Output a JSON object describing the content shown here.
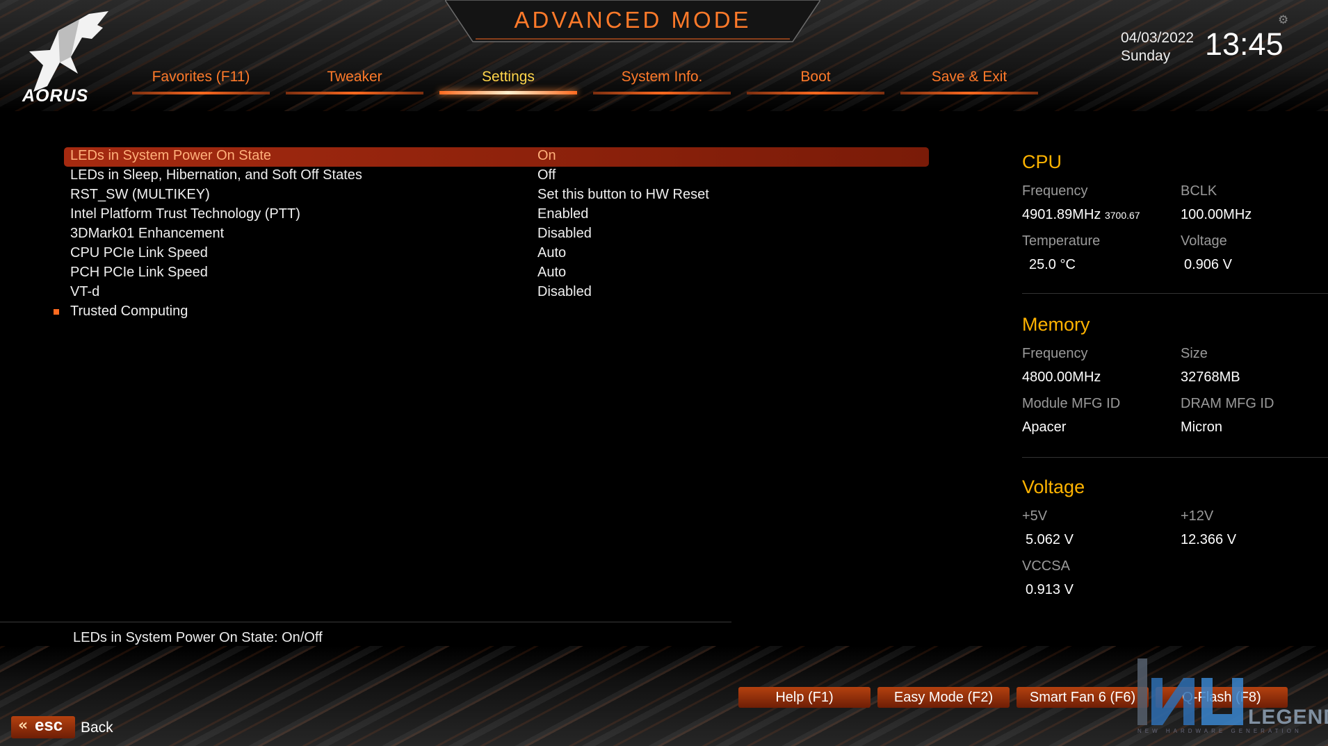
{
  "header": {
    "logo_text": "AORUS",
    "title": "ADVANCED MODE",
    "date": "04/03/2022",
    "day": "Sunday",
    "time": "13:45"
  },
  "tabs": [
    {
      "label": "Favorites (F11)",
      "active": false
    },
    {
      "label": "Tweaker",
      "active": false
    },
    {
      "label": "Settings",
      "active": true
    },
    {
      "label": "System Info.",
      "active": false
    },
    {
      "label": "Boot",
      "active": false
    },
    {
      "label": "Save & Exit",
      "active": false
    }
  ],
  "settings": [
    {
      "label": "LEDs in System Power On State",
      "value": "On",
      "selected": true
    },
    {
      "label": "LEDs in Sleep, Hibernation, and Soft Off States",
      "value": "Off"
    },
    {
      "label": "RST_SW (MULTIKEY)",
      "value": "Set this button to HW Reset"
    },
    {
      "label": "Intel Platform Trust Technology (PTT)",
      "value": "Enabled"
    },
    {
      "label": "3DMark01 Enhancement",
      "value": "Disabled"
    },
    {
      "label": "CPU PCIe Link Speed",
      "value": "Auto"
    },
    {
      "label": "PCH PCIe Link Speed",
      "value": "Auto"
    },
    {
      "label": "VT-d",
      "value": "Disabled"
    },
    {
      "label": "Trusted Computing",
      "value": "",
      "submenu": true
    }
  ],
  "help_text": "LEDs in System Power On State: On/Off",
  "cpu": {
    "title": "CPU",
    "frequency_label": "Frequency",
    "frequency": "4901.89MHz",
    "frequency_sub": "3700.67",
    "bclk_label": "BCLK",
    "bclk": "100.00MHz",
    "temperature_label": "Temperature",
    "temperature": "25.0 °C",
    "voltage_label": "Voltage",
    "voltage": "0.906 V"
  },
  "memory": {
    "title": "Memory",
    "frequency_label": "Frequency",
    "frequency": "4800.00MHz",
    "size_label": "Size",
    "size": "32768MB",
    "module_mfg_label": "Module MFG ID",
    "module_mfg": "Apacer",
    "dram_mfg_label": "DRAM MFG ID",
    "dram_mfg": "Micron"
  },
  "voltage": {
    "title": "Voltage",
    "v5_label": "+5V",
    "v5": "5.062 V",
    "v12_label": "+12V",
    "v12": "12.366 V",
    "vccsa_label": "VCCSA",
    "vccsa": "0.913 V"
  },
  "function_keys": [
    {
      "label": "Help (F1)"
    },
    {
      "label": "Easy Mode (F2)"
    },
    {
      "label": "Smart Fan 6 (F6)"
    },
    {
      "label": "Q-Flash (F8)"
    }
  ],
  "footer": {
    "esc_glyph": "«",
    "esc_label": "esc",
    "back_label": "Back"
  },
  "watermark": {
    "text": "LEGEND",
    "subtext": "NEW HARDWARE GENERATION"
  },
  "colors": {
    "accent": "#ff7a2a",
    "active_tab": "#ffd54a",
    "section_title": "#ffb300",
    "selection": "#a52a10"
  }
}
